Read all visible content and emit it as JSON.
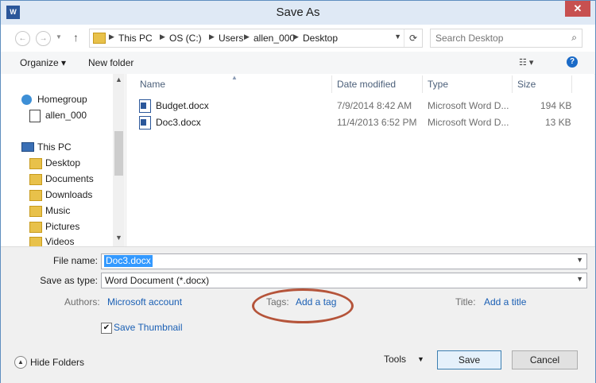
{
  "window": {
    "title": "Save As",
    "app_icon": "W",
    "close": "✕"
  },
  "nav": {
    "back": "←",
    "forward": "→",
    "up": "↑",
    "breadcrumbs": [
      "This PC",
      "OS (C:)",
      "Users",
      "allen_000",
      "Desktop"
    ],
    "search_placeholder": "Search Desktop"
  },
  "toolbar": {
    "organize": "Organize ▾",
    "new_folder": "New folder",
    "views": "☷ ▾",
    "help": "?"
  },
  "sidebar": {
    "items": [
      {
        "label": "Homegroup",
        "icon": "homegroup-icon"
      },
      {
        "label": "allen_000",
        "icon": "user-icon"
      },
      {
        "label": "This PC",
        "icon": "computer-icon"
      },
      {
        "label": "Desktop",
        "icon": "folder-icon"
      },
      {
        "label": "Documents",
        "icon": "folder-icon"
      },
      {
        "label": "Downloads",
        "icon": "folder-icon"
      },
      {
        "label": "Music",
        "icon": "folder-icon"
      },
      {
        "label": "Pictures",
        "icon": "folder-icon"
      },
      {
        "label": "Videos",
        "icon": "folder-icon"
      }
    ]
  },
  "files": {
    "columns": [
      "Name",
      "Date modified",
      "Type",
      "Size"
    ],
    "rows": [
      {
        "name": "Budget.docx",
        "date": "7/9/2014 8:42 AM",
        "type": "Microsoft Word D...",
        "size": "194 KB"
      },
      {
        "name": "Doc3.docx",
        "date": "11/4/2013 6:52 PM",
        "type": "Microsoft Word D...",
        "size": "13 KB"
      }
    ]
  },
  "form": {
    "file_name_label": "File name:",
    "file_name_value": "Doc3.docx",
    "save_as_type_label": "Save as type:",
    "save_as_type_value": "Word Document (*.docx)",
    "authors_label": "Authors:",
    "authors_value": "Microsoft account",
    "tags_label": "Tags:",
    "tags_value": "Add a tag",
    "title_label": "Title:",
    "title_value": "Add a title",
    "save_thumbnail_label": "Save Thumbnail",
    "save_thumbnail_checked": true
  },
  "footer": {
    "hide_folders": "Hide Folders",
    "tools": "Tools",
    "save": "Save",
    "cancel": "Cancel"
  },
  "colors": {
    "accent": "#1a5fb4",
    "selection": "#3399ff",
    "highlight_ellipse": "#b5543a",
    "close": "#c75050"
  }
}
